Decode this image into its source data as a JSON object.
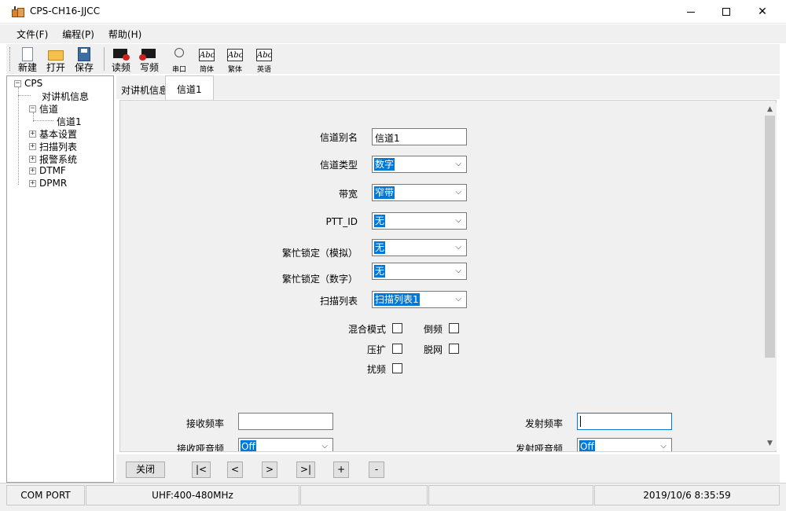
{
  "window": {
    "title": "CPS-CH16-JJCC"
  },
  "menu": {
    "items": [
      "文件(F)",
      "编程(P)",
      "帮助(H)"
    ]
  },
  "toolbar": {
    "new": "新建",
    "open": "打开",
    "save": "保存",
    "read": "读频",
    "write": "写频",
    "port": "串口",
    "simplified": "简体",
    "traditional": "繁体",
    "english": "英语",
    "abc_icon_text": "Abc"
  },
  "tree": {
    "root": "CPS",
    "radio_info": "对讲机信息",
    "channel": "信道",
    "channel1": "信道1",
    "basic": "基本设置",
    "scan": "扫描列表",
    "alarm": "报警系统",
    "dtmf": "DTMF",
    "dpmr": "DPMR",
    "expand_minus": "−",
    "expand_plus": "+"
  },
  "tabs": {
    "inactive": "对讲机信息",
    "active": "信道1"
  },
  "form": {
    "alias_label": "信道别名",
    "alias_value": "信道1",
    "type_label": "信道类型",
    "type_value": "数字",
    "bandwidth_label": "带宽",
    "bandwidth_value": "窄带",
    "ptt_label": "PTT_ID",
    "ptt_value": "无",
    "busy_analog_label": "繁忙锁定（模拟）",
    "busy_analog_value": "无",
    "busy_digital_label": "繁忙锁定（数字）",
    "busy_digital_value": "无",
    "scan_label": "扫描列表",
    "scan_value": "扫描列表1",
    "mixed_label": "混合模式",
    "reverse_label": "倒频",
    "compand_label": "压扩",
    "offnet_label": "脱网",
    "scramble_label": "扰频",
    "rx_freq_label": "接收频率",
    "tx_freq_label": "发射频率",
    "rx_tone_label": "接收哑音频",
    "rx_tone_value": "Off",
    "tx_tone_label": "发射哑音频",
    "tx_tone_value": "Off",
    "dropdown_icon": "chevron-down-icon"
  },
  "nav": {
    "close": "关闭",
    "first": "|<",
    "prev": "<",
    "next": ">",
    "last": ">|",
    "add": "+",
    "remove": "-"
  },
  "status": {
    "port": "COM PORT",
    "band": "UHF:400-480MHz",
    "datetime": "2019/10/6 8:35:59"
  }
}
